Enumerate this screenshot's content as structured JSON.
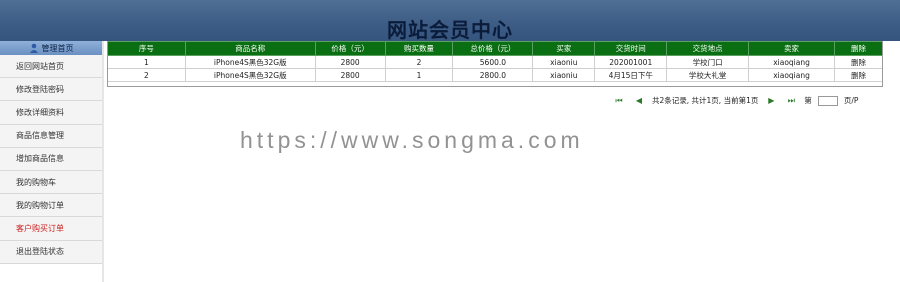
{
  "header": {
    "title": "网站会员中心"
  },
  "sidebar": {
    "title": "管理首页",
    "title_icon": "user-icon",
    "items": [
      {
        "label": "返回网站首页"
      },
      {
        "label": "修改登陆密码"
      },
      {
        "label": "修改详细资料"
      },
      {
        "label": "商品信息管理"
      },
      {
        "label": "增加商品信息"
      },
      {
        "label": "我的购物车"
      },
      {
        "label": "我的购物订单"
      },
      {
        "label": "客户购买订单"
      },
      {
        "label": "退出登陆状态"
      }
    ],
    "active_index": 7
  },
  "table": {
    "headers": [
      "序号",
      "商品名称",
      "价格（元）",
      "购买数量",
      "总价格（元）",
      "买家",
      "交货时间",
      "交货地点",
      "卖家",
      "删除"
    ],
    "rows": [
      [
        "1",
        "iPhone4S黑色32G版",
        "2800",
        "2",
        "5600.0",
        "xiaoniu",
        "202001001",
        "学校门口",
        "xiaoqiang",
        "删除"
      ],
      [
        "2",
        "iPhone4S黑色32G版",
        "2800",
        "1",
        "2800.0",
        "xiaoniu",
        "4月15日下午",
        "学校大礼堂",
        "xiaoqiang",
        "删除"
      ]
    ]
  },
  "pager": {
    "first_icon": "first-page-icon",
    "prev_icon": "prev-page-icon",
    "summary": "共2条记录, 共计1页, 当前第1页",
    "next_icon": "next-page-icon",
    "last_icon": "last-page-icon",
    "goto_prefix": "第",
    "goto_suffix": "页/P",
    "page_value": ""
  },
  "watermark": "https://www.songma.com",
  "colors": {
    "header_bg": "#3c5c85",
    "table_header_bg": "#0a6f12",
    "active_item": "#cc1f1f"
  }
}
